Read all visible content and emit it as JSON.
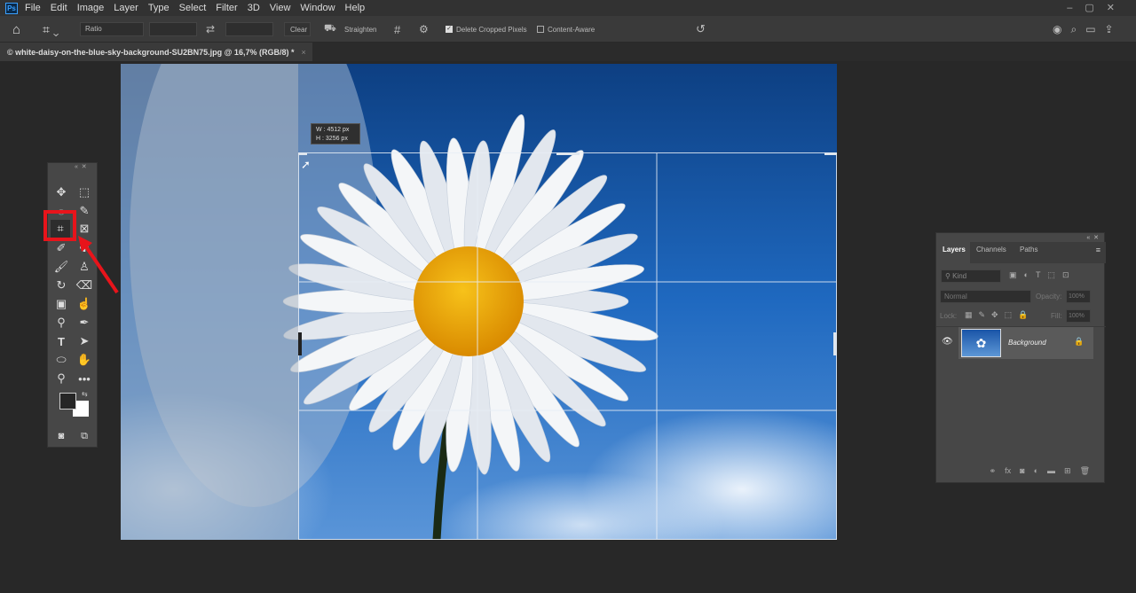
{
  "app": {
    "logo": "Ps"
  },
  "menu": [
    "File",
    "Edit",
    "Image",
    "Layer",
    "Type",
    "Select",
    "Filter",
    "3D",
    "View",
    "Window",
    "Help"
  ],
  "options": {
    "ratio": "Ratio",
    "clear": "Clear",
    "straighten": "Straighten",
    "delete_cropped": "Delete Cropped Pixels",
    "delete_cropped_checked": true,
    "content_aware": "Content-Aware",
    "content_aware_checked": false
  },
  "document_tab": {
    "title": "© white-daisy-on-the-blue-sky-background-SU2BN75.jpg @ 16,7% (RGB/8) *",
    "close": "×"
  },
  "crop_tooltip": {
    "w_label": "W :",
    "w": "4512 px",
    "h_label": "H :",
    "h": "3256 px"
  },
  "layers_panel": {
    "tabs": [
      "Layers",
      "Channels",
      "Paths"
    ],
    "filter": "Kind",
    "blend_mode": "Normal",
    "opacity_label": "Opacity:",
    "opacity": "100%",
    "lock_label": "Lock:",
    "fill_label": "Fill:",
    "fill": "100%",
    "layers": [
      {
        "name": "Background",
        "visible": true,
        "locked": true
      }
    ]
  },
  "colors": {
    "accent_red": "#e8141b",
    "sky": "#1c5fb0"
  }
}
